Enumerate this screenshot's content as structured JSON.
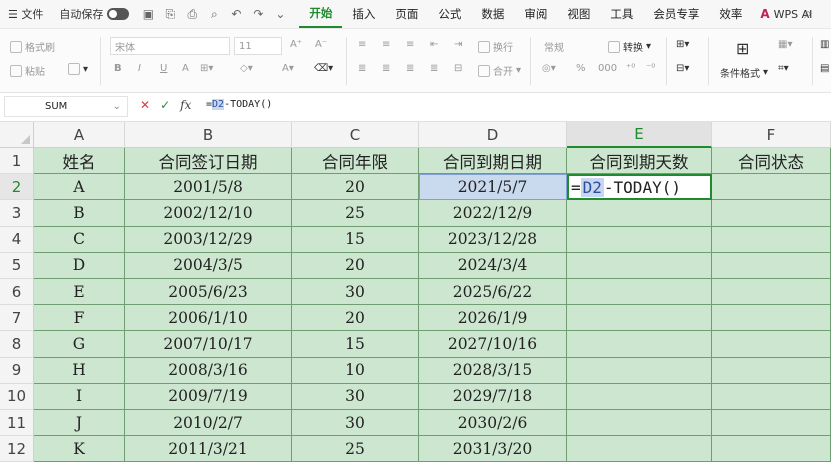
{
  "menubar": {
    "file": "文件",
    "autosave": "自动保存",
    "tabs": [
      "开始",
      "插入",
      "页面",
      "公式",
      "数据",
      "审阅",
      "视图",
      "工具",
      "会员专享",
      "效率"
    ],
    "active_tab": "开始",
    "wps_ai": "WPS AI"
  },
  "ribbon": {
    "format_painter": "格式刷",
    "paste": "粘贴",
    "font_name": "宋体",
    "font_size": "11",
    "wrap": "换行",
    "number_format": "常规",
    "convert": "转换",
    "merge": "合开",
    "cond_format": "条件格式"
  },
  "formula_bar": {
    "name_box": "SUM",
    "formula_prefix": "=",
    "formula_ref": "D2",
    "formula_suffix": "-TODAY()"
  },
  "sheet": {
    "columns": [
      "A",
      "B",
      "C",
      "D",
      "E",
      "F"
    ],
    "row_numbers": [
      "1",
      "2",
      "3",
      "4",
      "5",
      "6",
      "7",
      "8",
      "9",
      "10",
      "11",
      "12"
    ],
    "header": [
      "姓名",
      "合同签订日期",
      "合同年限",
      "合同到期日期",
      "合同到期天数",
      "合同状态"
    ],
    "rows": [
      [
        "A",
        "2001/5/8",
        "20",
        "2021/5/7",
        "",
        ""
      ],
      [
        "B",
        "2002/12/10",
        "25",
        "2022/12/9",
        "",
        ""
      ],
      [
        "C",
        "2003/12/29",
        "15",
        "2023/12/28",
        "",
        ""
      ],
      [
        "D",
        "2004/3/5",
        "20",
        "2024/3/4",
        "",
        ""
      ],
      [
        "E",
        "2005/6/23",
        "30",
        "2025/6/22",
        "",
        ""
      ],
      [
        "F",
        "2006/1/10",
        "20",
        "2026/1/9",
        "",
        ""
      ],
      [
        "G",
        "2007/10/17",
        "15",
        "2027/10/16",
        "",
        ""
      ],
      [
        "H",
        "2008/3/16",
        "10",
        "2028/3/15",
        "",
        ""
      ],
      [
        "I",
        "2009/7/19",
        "30",
        "2029/7/18",
        "",
        ""
      ],
      [
        "J",
        "2010/2/7",
        "30",
        "2030/2/6",
        "",
        ""
      ],
      [
        "K",
        "2011/3/21",
        "25",
        "2031/3/20",
        "",
        ""
      ]
    ],
    "editing_cell": {
      "prefix": "=",
      "ref": "D2",
      "suffix": "-TODAY()"
    }
  }
}
